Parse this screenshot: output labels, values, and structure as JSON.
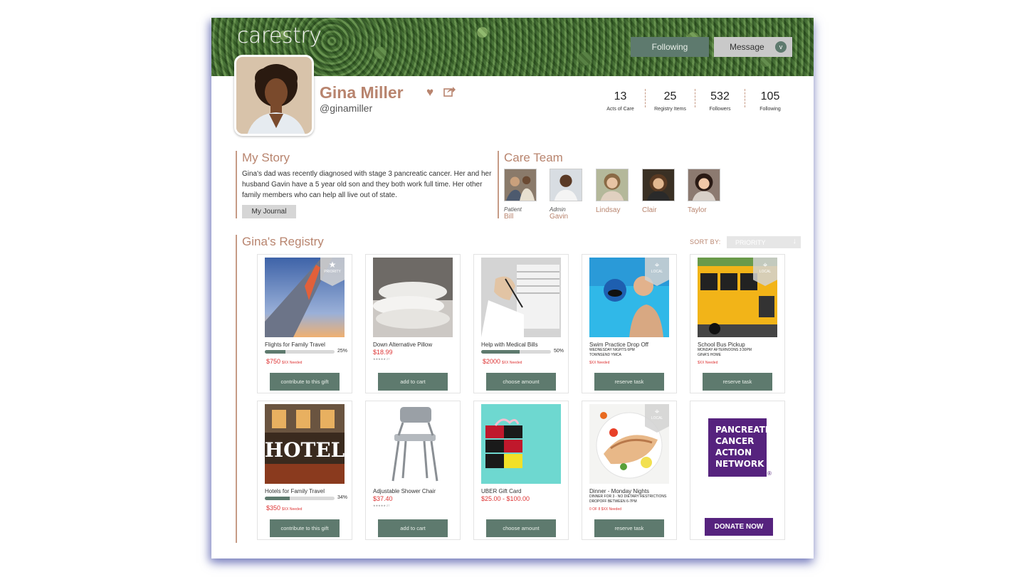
{
  "app": {
    "logo_text": "carestry"
  },
  "header": {
    "following_label": "Following",
    "message_label": "Message",
    "message_chevron": "v"
  },
  "profile": {
    "name": "Gina Miller",
    "handle": "@ginamiller",
    "stats": [
      {
        "value": "13",
        "label": "Acts of Care"
      },
      {
        "value": "25",
        "label": "Registry Items"
      },
      {
        "value": "532",
        "label": "Followers"
      },
      {
        "value": "105",
        "label": "Following"
      }
    ]
  },
  "story": {
    "title": "My Story",
    "text": "Gina's dad was recently diagnosed with stage 3 pancreatic cancer.   Her and her husband Gavin have a 5 year old son and they both work full time. Her other family members who can help all live out of state.",
    "journal_label": "My Journal"
  },
  "care_team": {
    "title": "Care Team",
    "members": [
      {
        "role": "Patient",
        "name": "Bill"
      },
      {
        "role": "Admin",
        "name": "Gavin"
      },
      {
        "role": "",
        "name": "Lindsay"
      },
      {
        "role": "",
        "name": "Clair"
      },
      {
        "role": "",
        "name": "Taylor"
      }
    ]
  },
  "registry": {
    "title": "Gina's Registry",
    "sort_label": "SORT BY:",
    "sort_value": "PRIORITY",
    "items": [
      {
        "title": "Flights for Family Travel",
        "progress_pct": "25%",
        "price": "$750",
        "needed": "$XX Needed",
        "action": "contribute to this gift",
        "badge": "PRIORITY"
      },
      {
        "title": "Down Alternative Pillow",
        "price": "$18.99",
        "stars": "★★★★★ 27",
        "action": "add to cart"
      },
      {
        "title": "Help with Medical Bills",
        "progress_pct": "50%",
        "price": "$2000",
        "needed": "$XX Needed",
        "action": "choose amount"
      },
      {
        "title": "Swim Practice Drop Off",
        "details": [
          "WEDNESDAY NIGHTS 6PM",
          "TOWNSEND YMCA"
        ],
        "needed": "$XX Needed",
        "action": "reserve task",
        "badge": "LOCAL"
      },
      {
        "title": "School Bus Pickup",
        "details": [
          "MONDAY AFTERNOONS 3:30PM",
          "GINA'S HOME"
        ],
        "needed": "$XX Needed",
        "action": "reserve task",
        "badge": "LOCAL"
      },
      {
        "title": "Hotels for Family Travel",
        "progress_pct": "34%",
        "price": "$350",
        "needed": "$XX Needed",
        "action": "contribute to this gift"
      },
      {
        "title": "Adjustable Shower Chair",
        "price": "$37.40",
        "stars": "★★★★★ 27",
        "action": "add to cart"
      },
      {
        "title": "UBER Gift Card",
        "price": "$25.00 - $100.00",
        "action": "choose amount"
      },
      {
        "title": "Dinner - Monday Nights",
        "details": [
          "DINNER FOR 3 - NO DIETARY RESTRICTIONS",
          "DROPOFF BETWEEN 6-7PM"
        ],
        "needed": "0 OF 8 $XX Needed",
        "action": "reserve task",
        "badge": "LOCAL"
      },
      {
        "logo_lines": [
          "PANCREATIC",
          "CANCER",
          "ACTION",
          "NETWORK"
        ],
        "action": "DONATE NOW"
      }
    ]
  },
  "colors": {
    "accent": "#b8846e",
    "button": "#5e7a6e",
    "purple": "#56237e",
    "price": "#dd3333"
  }
}
